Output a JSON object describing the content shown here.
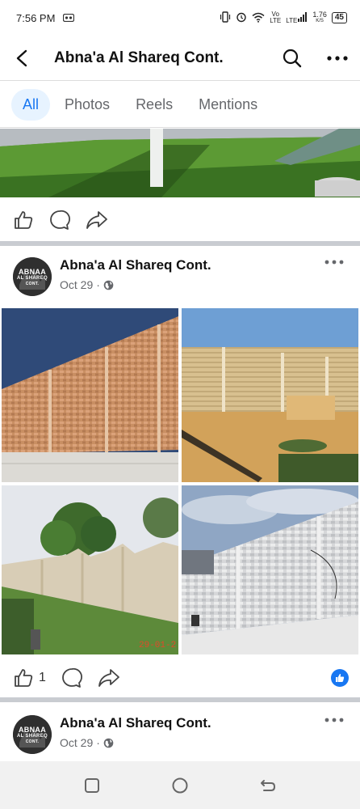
{
  "status_bar": {
    "time": "7:56 PM",
    "network_label_1": "Vo",
    "network_label_2": "LTE",
    "lte_label": "LTE",
    "speed_value": "1.76",
    "speed_unit": "K/S",
    "battery": "45"
  },
  "header": {
    "title": "Abna'a Al Shareq Cont."
  },
  "tabs": [
    {
      "label": "All",
      "active": true
    },
    {
      "label": "Photos",
      "active": false
    },
    {
      "label": "Reels",
      "active": false
    },
    {
      "label": "Mentions",
      "active": false
    }
  ],
  "posts": [
    {
      "author": "Abna'a Al Shareq Cont.",
      "date": "Oct 29",
      "separator": "·",
      "like_count": "1",
      "photo_timestamp": "29-01-2",
      "avatar_text_1": "ABNAA",
      "avatar_text_2": "AL SHAREQ",
      "avatar_text_3": "CONT."
    },
    {
      "author": "Abna'a Al Shareq Cont.",
      "date": "Oct 29",
      "separator": "·",
      "avatar_text_1": "ABNAA",
      "avatar_text_2": "AL SHAREQ",
      "avatar_text_3": "CONT."
    }
  ],
  "colors": {
    "accent": "#1877f2",
    "tab_active_bg": "#e7f3ff",
    "secondary_text": "#65676b",
    "separator": "#c9ccd1"
  },
  "icons": [
    "back-arrow-icon",
    "search-icon",
    "more-icon",
    "like-icon",
    "comment-icon",
    "share-icon",
    "globe-icon",
    "like-reaction-icon",
    "recent-apps-icon",
    "home-icon",
    "back-nav-icon"
  ]
}
